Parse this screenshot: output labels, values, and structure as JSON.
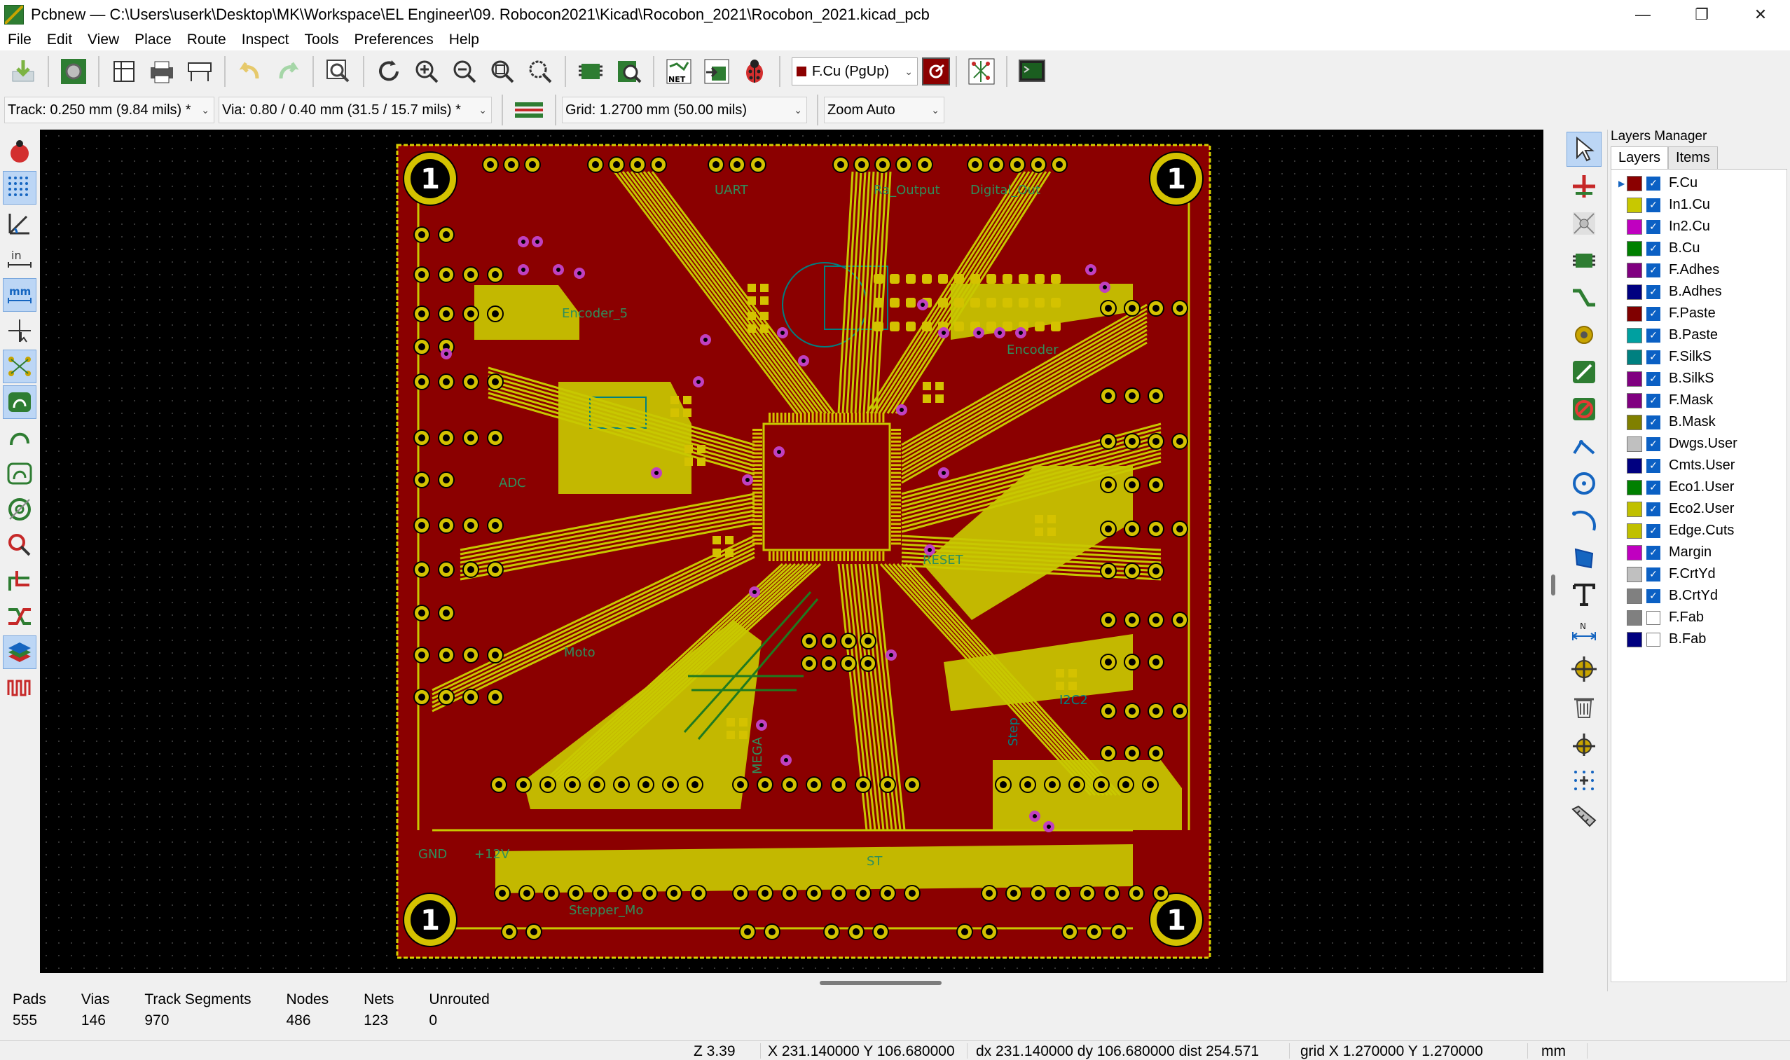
{
  "window": {
    "title": "Pcbnew — C:\\Users\\userk\\Desktop\\MK\\Workspace\\EL Engineer\\09. Robocon2021\\Kicad\\Rocobon_2021\\Rocobon_2021.kicad_pcb"
  },
  "menu": [
    "File",
    "Edit",
    "View",
    "Place",
    "Route",
    "Inspect",
    "Tools",
    "Preferences",
    "Help"
  ],
  "toolbar": {
    "active_layer": "F.Cu (PgUp)",
    "active_layer_color": "#8b0000"
  },
  "toolbar2": {
    "track": "Track: 0.250 mm (9.84 mils) *",
    "via": "Via: 0.80 / 0.40 mm (31.5 / 15.7 mils) *",
    "grid": "Grid: 1.2700 mm (50.00 mils)",
    "zoom": "Zoom Auto"
  },
  "board": {
    "copper_color": "#8b0000",
    "track_color": "#c8c800",
    "pad_color": "#d4c200",
    "via_color": "#c040c0",
    "silk_color": "#008080",
    "labels": [
      "Encoder_5",
      "ADC",
      "Moto",
      "I2C2",
      "Encoder",
      "Digital_Out",
      "Ra_Output",
      "UART",
      "Step",
      "Stepper_Mo",
      "MEGA",
      "ST",
      "RESET",
      "GND",
      "+12V"
    ],
    "mount_holes": [
      "1",
      "1",
      "1",
      "1"
    ]
  },
  "layers_manager": {
    "title": "Layers Manager",
    "tabs": [
      "Layers",
      "Items"
    ],
    "layers": [
      {
        "name": "F.Cu",
        "color": "#8b0000",
        "checked": true,
        "active": true
      },
      {
        "name": "In1.Cu",
        "color": "#c8c800",
        "checked": true
      },
      {
        "name": "In2.Cu",
        "color": "#c000c0",
        "checked": true
      },
      {
        "name": "B.Cu",
        "color": "#008000",
        "checked": true
      },
      {
        "name": "F.Adhes",
        "color": "#800080",
        "checked": true
      },
      {
        "name": "B.Adhes",
        "color": "#000080",
        "checked": true
      },
      {
        "name": "F.Paste",
        "color": "#800000",
        "checked": true
      },
      {
        "name": "B.Paste",
        "color": "#00a0a0",
        "checked": true
      },
      {
        "name": "F.SilkS",
        "color": "#008080",
        "checked": true
      },
      {
        "name": "B.SilkS",
        "color": "#800080",
        "checked": true
      },
      {
        "name": "F.Mask",
        "color": "#800080",
        "checked": true
      },
      {
        "name": "B.Mask",
        "color": "#808000",
        "checked": true
      },
      {
        "name": "Dwgs.User",
        "color": "#c0c0c0",
        "checked": true
      },
      {
        "name": "Cmts.User",
        "color": "#000080",
        "checked": true
      },
      {
        "name": "Eco1.User",
        "color": "#008000",
        "checked": true
      },
      {
        "name": "Eco2.User",
        "color": "#c0c000",
        "checked": true
      },
      {
        "name": "Edge.Cuts",
        "color": "#c0c000",
        "checked": true
      },
      {
        "name": "Margin",
        "color": "#c000c0",
        "checked": true
      },
      {
        "name": "F.CrtYd",
        "color": "#c0c0c0",
        "checked": true
      },
      {
        "name": "B.CrtYd",
        "color": "#808080",
        "checked": true
      },
      {
        "name": "F.Fab",
        "color": "#808080",
        "checked": false
      },
      {
        "name": "B.Fab",
        "color": "#000080",
        "checked": false
      }
    ]
  },
  "stats": [
    {
      "label": "Pads",
      "value": "555"
    },
    {
      "label": "Vias",
      "value": "146"
    },
    {
      "label": "Track Segments",
      "value": "970"
    },
    {
      "label": "Nodes",
      "value": "486"
    },
    {
      "label": "Nets",
      "value": "123"
    },
    {
      "label": "Unrouted",
      "value": "0"
    }
  ],
  "status": {
    "zoom": "Z 3.39",
    "xy": "X 231.140000  Y 106.680000",
    "dxy": "dx 231.140000  dy 106.680000  dist 254.571",
    "grid": "grid X 1.270000  Y 1.270000",
    "units": "mm"
  }
}
